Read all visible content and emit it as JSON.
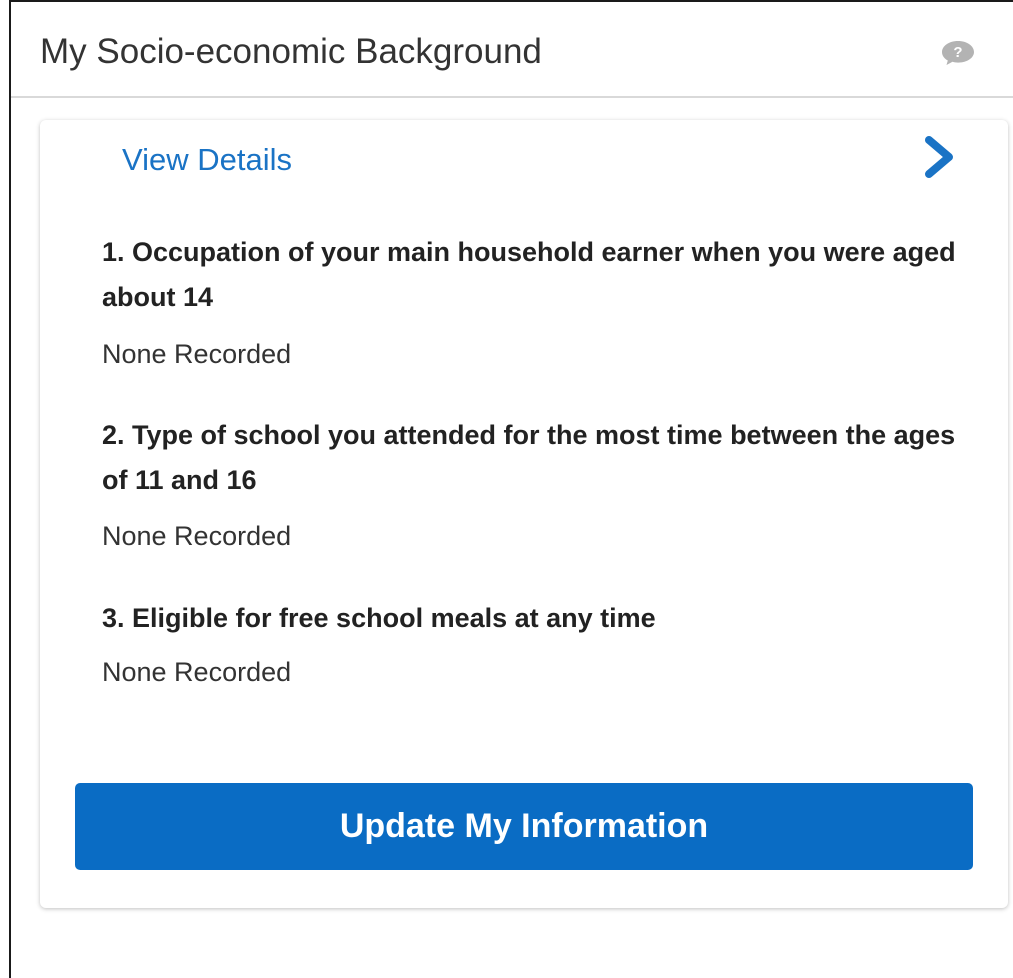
{
  "widget": {
    "title": "My Socio-economic Background",
    "help_icon": "speech-bubble-question-icon"
  },
  "card": {
    "view_details_label": "View Details",
    "chevron_icon": "chevron-right-icon",
    "questions": [
      {
        "label": "1. Occupation of your main household earner when you were aged about 14",
        "answer": "None Recorded"
      },
      {
        "label": "2. Type of school you attended for the most time between the ages of 11 and 16",
        "answer": "None Recorded"
      },
      {
        "label": "3. Eligible for free school meals at any time",
        "answer": "None Recorded"
      }
    ],
    "update_button_label": "Update My Information"
  },
  "colors": {
    "link": "#1a73c5",
    "button": "#0a6cc4",
    "button_text": "#ffffff",
    "header_divider": "#d9d9d9",
    "help_icon": "#b3b3b3"
  }
}
